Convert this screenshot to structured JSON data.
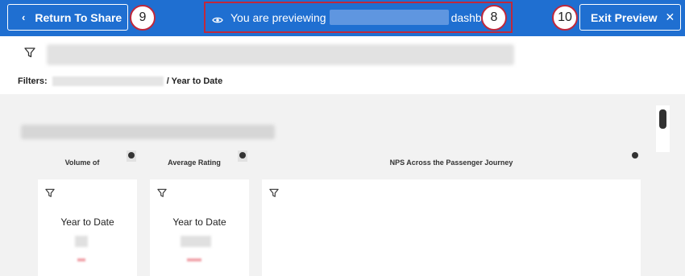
{
  "preview_bar": {
    "return_label": "Return To Share",
    "preview_prefix": "You are previewing",
    "preview_suffix": "dashboard",
    "exit_label": "Exit Preview",
    "callouts": [
      "9",
      "8",
      "10"
    ],
    "colors": {
      "bar": "#1f6fd1",
      "callout_border": "#c0283b"
    }
  },
  "header": {
    "filters_label": "Filters:",
    "filters_value": "/ Year to Date"
  },
  "widgets": [
    {
      "title": "Volume of",
      "period": "Year to Date"
    },
    {
      "title": "Average Rating",
      "period": "Year to Date"
    },
    {
      "title": "NPS Across the Passenger Journey"
    }
  ]
}
